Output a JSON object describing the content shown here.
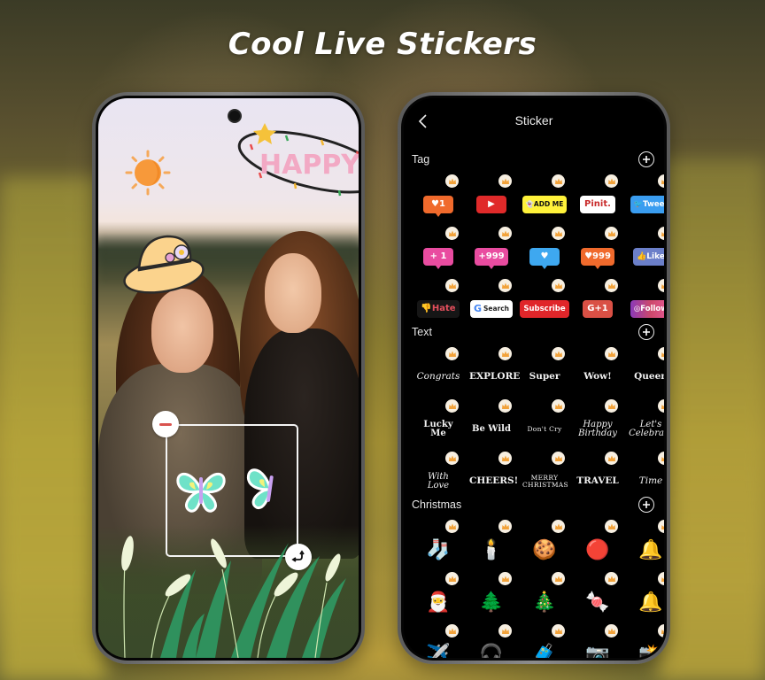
{
  "headline": "Cool Live Stickers",
  "editor": {
    "overlay_stickers": [
      "sun",
      "happy-text",
      "straw-hat",
      "butterfly",
      "butterfly",
      "grass-reeds"
    ],
    "happy_text": "HAPPY",
    "selection_controls": {
      "remove_icon": "minus-icon",
      "rotate_icon": "rotate-scale-icon"
    }
  },
  "sticker_panel": {
    "title": "Sticker",
    "back_icon": "chevron-left-icon",
    "premium_badge_icon": "crown-icon",
    "sections": [
      {
        "label": "Tag",
        "add_icon": "plus-circle-icon",
        "items": [
          {
            "name": "like-1",
            "text": "♥1",
            "style": "t-orange",
            "tail": true
          },
          {
            "name": "youtube",
            "text": "▶",
            "style": "t-red",
            "tail": false
          },
          {
            "name": "snapchat-add-me",
            "text": "👻ADD ME",
            "style": "t-yellow",
            "tail": false
          },
          {
            "name": "pin-it",
            "text": "Pinit.",
            "style": "t-white",
            "tail": false
          },
          {
            "name": "tweet",
            "text": "🐦Tweet",
            "style": "t-tw",
            "tail": false
          },
          {
            "name": "plus-1",
            "text": "+ 1",
            "style": "t-pink",
            "tail": true
          },
          {
            "name": "plus-999",
            "text": "+999",
            "style": "t-pink",
            "tail": true
          },
          {
            "name": "heart-bubble",
            "text": "♥",
            "style": "t-blue",
            "tail": true
          },
          {
            "name": "heart-999",
            "text": "♥999",
            "style": "t-orange",
            "tail": true
          },
          {
            "name": "facebook-like",
            "text": "👍Like",
            "style": "t-fb",
            "tail": false
          },
          {
            "name": "hate",
            "text": "👎Hate",
            "style": "t-dark",
            "tail": false
          },
          {
            "name": "google-search",
            "text": "Search",
            "style": "t-g",
            "tail": false
          },
          {
            "name": "subscribe",
            "text": "Subscribe",
            "style": "t-sub",
            "tail": false
          },
          {
            "name": "google-plus-1",
            "text": "G+1",
            "style": "t-gp",
            "tail": false
          },
          {
            "name": "instagram-follow",
            "text": "◎Follow",
            "style": "t-ig",
            "tail": false
          }
        ]
      },
      {
        "label": "Text",
        "add_icon": "plus-circle-icon",
        "items": [
          {
            "name": "congrats",
            "text": "Congrats",
            "style": "script"
          },
          {
            "name": "explore",
            "text": "EXPLORE",
            "style": "bold"
          },
          {
            "name": "super",
            "text": "Super",
            "style": "bold"
          },
          {
            "name": "wow",
            "text": "Wow!",
            "style": "bold"
          },
          {
            "name": "queen",
            "text": "Queen",
            "style": "bold"
          },
          {
            "name": "lucky-me",
            "text": "Lucky Me",
            "style": "bold two"
          },
          {
            "name": "be-wild",
            "text": "Be Wild",
            "style": "bold two"
          },
          {
            "name": "dont-cry",
            "text": "Don't Cry",
            "style": "small"
          },
          {
            "name": "happy-birthday",
            "text": "Happy Birthday",
            "style": "script two"
          },
          {
            "name": "lets-celebrate",
            "text": "Let's Celebrate",
            "style": "script two"
          },
          {
            "name": "with-love",
            "text": "With Love",
            "style": "script two"
          },
          {
            "name": "cheers",
            "text": "CHEERS!",
            "style": "bold"
          },
          {
            "name": "merry-christmas",
            "text": "MERRY CHRISTMAS",
            "style": "small"
          },
          {
            "name": "travel",
            "text": "TRAVEL",
            "style": "bold"
          },
          {
            "name": "time",
            "text": "Time",
            "style": "script"
          }
        ]
      },
      {
        "label": "Christmas",
        "add_icon": "plus-circle-icon",
        "items": [
          {
            "name": "stocking",
            "text": "🧦"
          },
          {
            "name": "candle",
            "text": "🕯️"
          },
          {
            "name": "gingerbread",
            "text": "🍪"
          },
          {
            "name": "ornament",
            "text": "🔴"
          },
          {
            "name": "bells",
            "text": "🔔"
          },
          {
            "name": "santa-hat",
            "text": "🎅"
          },
          {
            "name": "sparkle-tree",
            "text": "🌲"
          },
          {
            "name": "dark-tree",
            "text": "🎄"
          },
          {
            "name": "candy",
            "text": "🍬"
          },
          {
            "name": "bell-bow",
            "text": "🔔"
          },
          {
            "name": "airplane",
            "text": "✈️"
          },
          {
            "name": "headphones",
            "text": "🎧"
          },
          {
            "name": "suitcase",
            "text": "🧳"
          },
          {
            "name": "camera-strap",
            "text": "📷"
          },
          {
            "name": "instant-camera",
            "text": "📸"
          }
        ]
      }
    ]
  }
}
